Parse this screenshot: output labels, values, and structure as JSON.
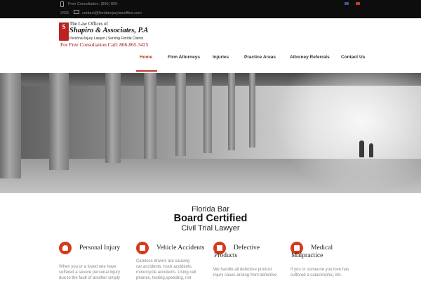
{
  "topbar": {
    "phone": "Free Consultation: (866) 865-",
    "phone_cont": "3425",
    "email": "contact@floridainjurylawoffice.com"
  },
  "logo": {
    "seal": "S",
    "line1": "The Law Offices of",
    "line2": "Shapiro & Associates, P.A",
    "line3": "Personal Injury Lawyer  |  Serving Florida Clients",
    "line4": "For Free Consultation Call: 866.865.3425"
  },
  "nav": {
    "items": [
      {
        "label": "Home"
      },
      {
        "label": "Firm Attorneys"
      },
      {
        "label": "Injuries"
      },
      {
        "label": "Practice Areas"
      },
      {
        "label": "Attorney Referrals"
      },
      {
        "label": "Contact Us"
      }
    ],
    "accent": "#c0392b"
  },
  "board": {
    "line1": "Florida Bar",
    "line2": "Board Certified",
    "line3": "Civil Trial Lawyer"
  },
  "cards": [
    {
      "icon": "flame-icon",
      "title": "Personal Injury",
      "text": [
        "When you or a loved one have",
        "suffered a severe personal injury",
        "due to the fault of another simply"
      ]
    },
    {
      "icon": "car-icon",
      "title": "Vehicle Accidents",
      "text": [
        "Careless drivers are causing",
        "car accidents, truck accidents,",
        "motorcycle accidents. Using cell",
        "phones, texting,speeding, not"
      ]
    },
    {
      "icon": "product-icon",
      "title1": "Defective",
      "title2": "Products",
      "text": [
        "We handle all defective product",
        "injury cases arising from defective"
      ]
    },
    {
      "icon": "medical-kit-icon",
      "title1": "Medical",
      "title2": "Malpractice",
      "text": [
        "If you or someone you love has",
        "suffered a catastrophic, life-"
      ]
    }
  ]
}
